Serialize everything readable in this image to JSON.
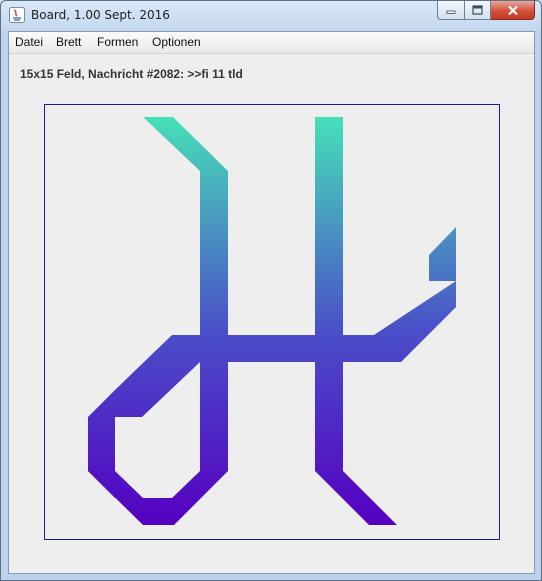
{
  "window": {
    "title": "Board, 1.00 Sept. 2016",
    "controls": [
      "minimize-icon",
      "maximize-icon",
      "close-icon"
    ]
  },
  "menu": {
    "items": [
      "Datei",
      "Brett",
      "Formen",
      "Optionen"
    ]
  },
  "status": {
    "text": "15x15 Feld, Nachricht #2082: >>fi 11 tld"
  },
  "board": {
    "grid_size": 15,
    "drawing": "glyph path on grid",
    "colors": {
      "top": "#46e0b8",
      "middle": "#4a50c8",
      "bottom": "#5400c0",
      "border": "#1a1aa8",
      "background": "#eeeeee"
    }
  }
}
